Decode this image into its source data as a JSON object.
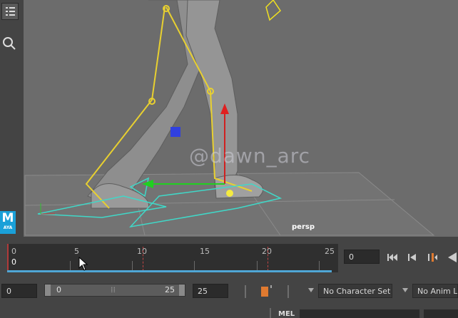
{
  "toolbox": {
    "icons": [
      "list-icon",
      "search-icon"
    ],
    "logo": {
      "letter": "M",
      "text": "AYA"
    }
  },
  "viewport": {
    "camera_label": "persp",
    "watermark": "@dawn_arc"
  },
  "timeline": {
    "ticks": [
      "0",
      "5",
      "10",
      "15",
      "20",
      "25"
    ],
    "current_frame": "0",
    "frame_field": "0"
  },
  "range": {
    "start_field": "0",
    "slider_start": "0",
    "slider_end": "25",
    "end_field": "25"
  },
  "dropdowns": {
    "character_set": "No Character Set",
    "anim_layer": "No Anim La"
  },
  "command_line": {
    "label": "MEL"
  },
  "colors": {
    "viewport_bg": "#6c6c6c",
    "joint_yellow": "#e8d030",
    "control_cyan": "#40d8c8",
    "playhead_red": "#b03a3a",
    "range_blue": "#4fa6d6",
    "maya_blue": "#1aa0d8"
  }
}
